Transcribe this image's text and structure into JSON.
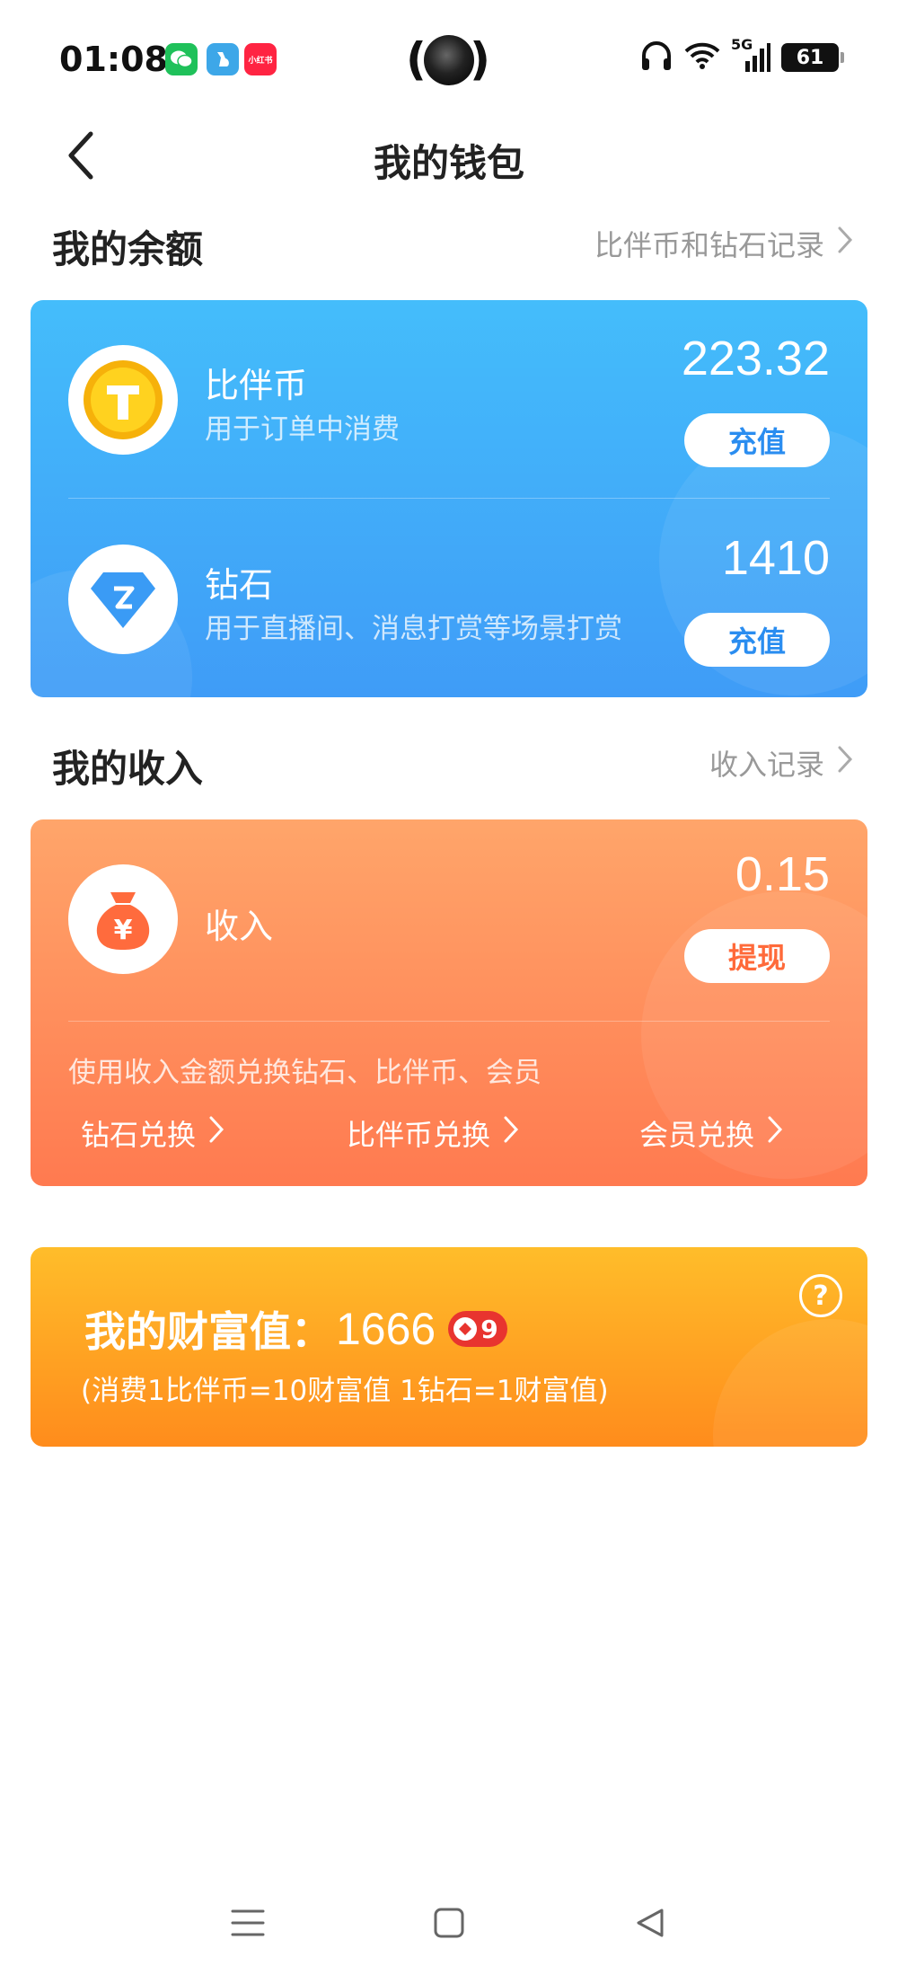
{
  "status_bar": {
    "time": "01:08",
    "apps": [
      "wechat-icon",
      "bird-app-icon",
      "xiaohongshu-icon"
    ],
    "xhs_label": "小红书",
    "network": "5G",
    "battery": "61"
  },
  "header": {
    "title": "我的钱包"
  },
  "balance_section": {
    "title": "我的余额",
    "link": "比伴币和钻石记录",
    "items": [
      {
        "icon": "coin-icon",
        "name": "比伴币",
        "desc": "用于订单中消费",
        "amount": "223.32",
        "button": "充值"
      },
      {
        "icon": "diamond-icon",
        "name": "钻石",
        "desc": "用于直播间、消息打赏等场景打赏",
        "amount": "1410",
        "button": "充值"
      }
    ]
  },
  "income_section": {
    "title": "我的收入",
    "link": "收入记录",
    "item": {
      "icon": "money-bag-icon",
      "name": "收入",
      "amount": "0.15",
      "button": "提现"
    },
    "exchange_hint": "使用收入金额兑换钻石、比伴币、会员",
    "exchanges": [
      "钻石兑换",
      "比伴币兑换",
      "会员兑换"
    ]
  },
  "wealth": {
    "label": "我的财富值：",
    "value": "1666",
    "level": "9",
    "note": "(消费1比伴币=10财富值 1钻石=1财富值)"
  },
  "colors": {
    "balance_card": "#3fa9f9",
    "income_card": "#ff8a58",
    "wealth_card": "#ffa224"
  }
}
